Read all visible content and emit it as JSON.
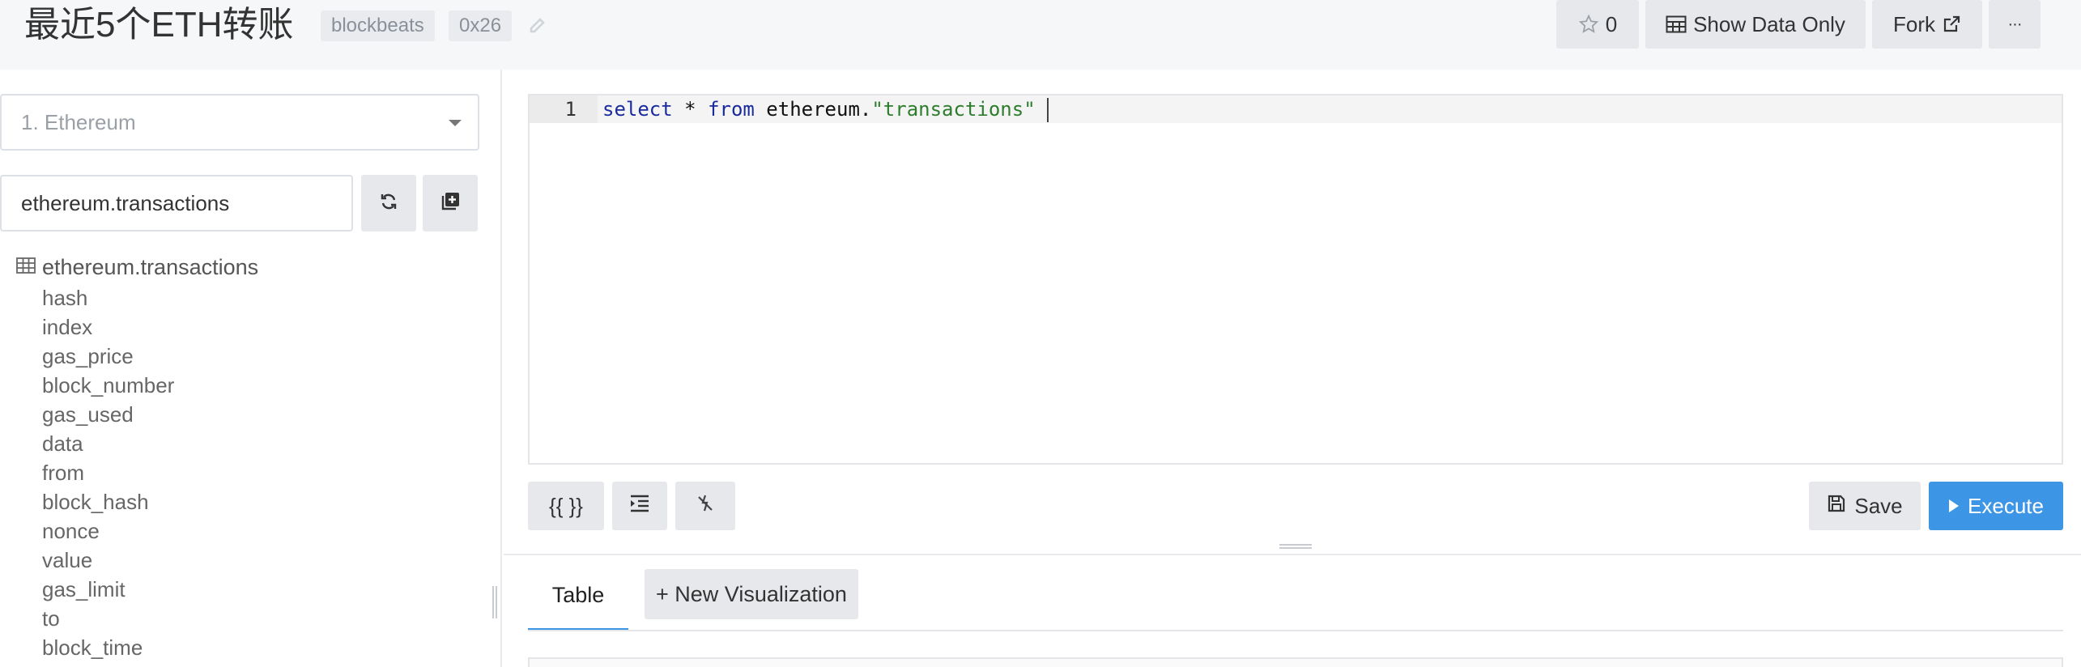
{
  "header": {
    "title": "最近5个ETH转账",
    "tags": [
      "blockbeats",
      "0x26"
    ],
    "star_count": "0",
    "show_data_only_label": "Show Data Only",
    "fork_label": "Fork",
    "more_label": "···"
  },
  "sidebar": {
    "data_source": "1. Ethereum",
    "search_value": "ethereum.transactions",
    "table_name": "ethereum.transactions",
    "columns": [
      "hash",
      "index",
      "gas_price",
      "block_number",
      "gas_used",
      "data",
      "from",
      "block_hash",
      "nonce",
      "value",
      "gas_limit",
      "to",
      "block_time"
    ]
  },
  "editor": {
    "line_number": "1",
    "code": {
      "kw1": "select",
      "mid1": " * ",
      "kw2": "from",
      "mid2": " ethereum.",
      "str": "\"transactions\""
    }
  },
  "toolbar": {
    "params_label": "{{ }}",
    "save_label": "Save",
    "execute_label": "Execute"
  },
  "results": {
    "tab_table": "Table",
    "new_visualization_label": "New Visualization"
  },
  "colors": {
    "accent": "#3d95e6",
    "keyword": "#1a2b9e",
    "string": "#2d7d2d"
  }
}
